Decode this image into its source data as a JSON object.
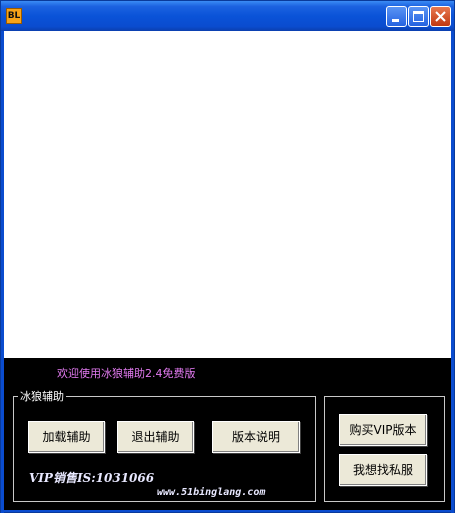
{
  "titlebar": {
    "icon_text": "BL",
    "icon_color": "#f7a318",
    "buttons": [
      "minimize-icon",
      "maximize-icon",
      "close-icon"
    ]
  },
  "panel": {
    "welcome": "欢迎使用冰狼辅助2.4免费版",
    "welcome_color": "#e27af0",
    "group_label": "冰狼辅助",
    "buttons": {
      "load": "加载辅助",
      "exit": "退出辅助",
      "version": "版本说明",
      "buy_vip": "购买VIP版本",
      "contact": "我想找私服"
    },
    "vip_sales": "VIP销售IS:1031066",
    "url": "www.51binglang.com"
  }
}
